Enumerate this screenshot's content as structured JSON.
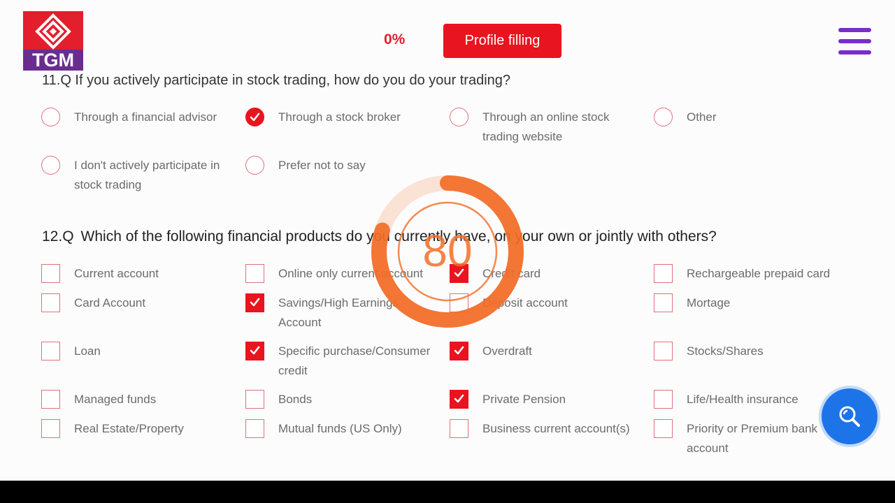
{
  "header": {
    "logo_text": "TGM",
    "progress": "0%",
    "profile_button": "Profile filling"
  },
  "q11": {
    "title": "11.Q  If you actively participate in stock trading, how do you do your trading?",
    "options": [
      {
        "label": "Through a financial advisor",
        "label2": "",
        "selected": false
      },
      {
        "label": "Through a stock broker",
        "label2": "",
        "selected": true
      },
      {
        "label": "Through an online stock",
        "label2": "trading website",
        "selected": false
      },
      {
        "label": "Other",
        "label2": "",
        "selected": false
      },
      {
        "label": "I don't actively participate in",
        "label2": "stock trading",
        "selected": false
      },
      {
        "label": "Prefer not to say",
        "label2": "",
        "selected": false
      }
    ]
  },
  "q12": {
    "number": "12.Q",
    "title": "Which of the following financial products do you currently have, on your own or jointly with others?",
    "options": [
      {
        "label": "Current account",
        "label2": "",
        "checked": false
      },
      {
        "label": "Online only current account",
        "label2": "",
        "checked": false
      },
      {
        "label": "Credit card",
        "label2": "",
        "checked": true
      },
      {
        "label": "Rechargeable prepaid card",
        "label2": "",
        "checked": false
      },
      {
        "label": "Card Account",
        "label2": "",
        "checked": false
      },
      {
        "label": "Savings/High Earnings",
        "label2": "Account",
        "checked": true
      },
      {
        "label": "Deposit account",
        "label2": "",
        "checked": false
      },
      {
        "label": "Mortage",
        "label2": "",
        "checked": false
      },
      {
        "label": "Loan",
        "label2": "",
        "checked": false
      },
      {
        "label": "Specific purchase/Consumer",
        "label2": "credit",
        "checked": true
      },
      {
        "label": "Overdraft",
        "label2": "",
        "checked": true
      },
      {
        "label": "Stocks/Shares",
        "label2": "",
        "checked": false
      },
      {
        "label": "Managed funds",
        "label2": "",
        "checked": false
      },
      {
        "label": "Bonds",
        "label2": "",
        "checked": false
      },
      {
        "label": "Private Pension",
        "label2": "",
        "checked": true
      },
      {
        "label": "Life/Health insurance",
        "label2": "",
        "checked": false
      },
      {
        "label": "Real Estate/Property",
        "label2": "",
        "checked": false
      },
      {
        "label": "Mutual funds (US Only)",
        "label2": "",
        "checked": false
      },
      {
        "label": "Business current account(s)",
        "label2": "",
        "checked": false
      },
      {
        "label": "Priority or Premium bank",
        "label2": "account",
        "checked": false
      }
    ]
  },
  "timer": {
    "value": "80",
    "fraction": 0.8
  },
  "colors": {
    "brand_red": "#e8141f",
    "menu_purple": "#7a2dc9",
    "timer_orange": "#f26d26",
    "fab_blue": "#1c74e8"
  },
  "icons": {
    "menu": "hamburger-menu-icon",
    "search": "search-icon",
    "logo": "tgm-logo"
  }
}
